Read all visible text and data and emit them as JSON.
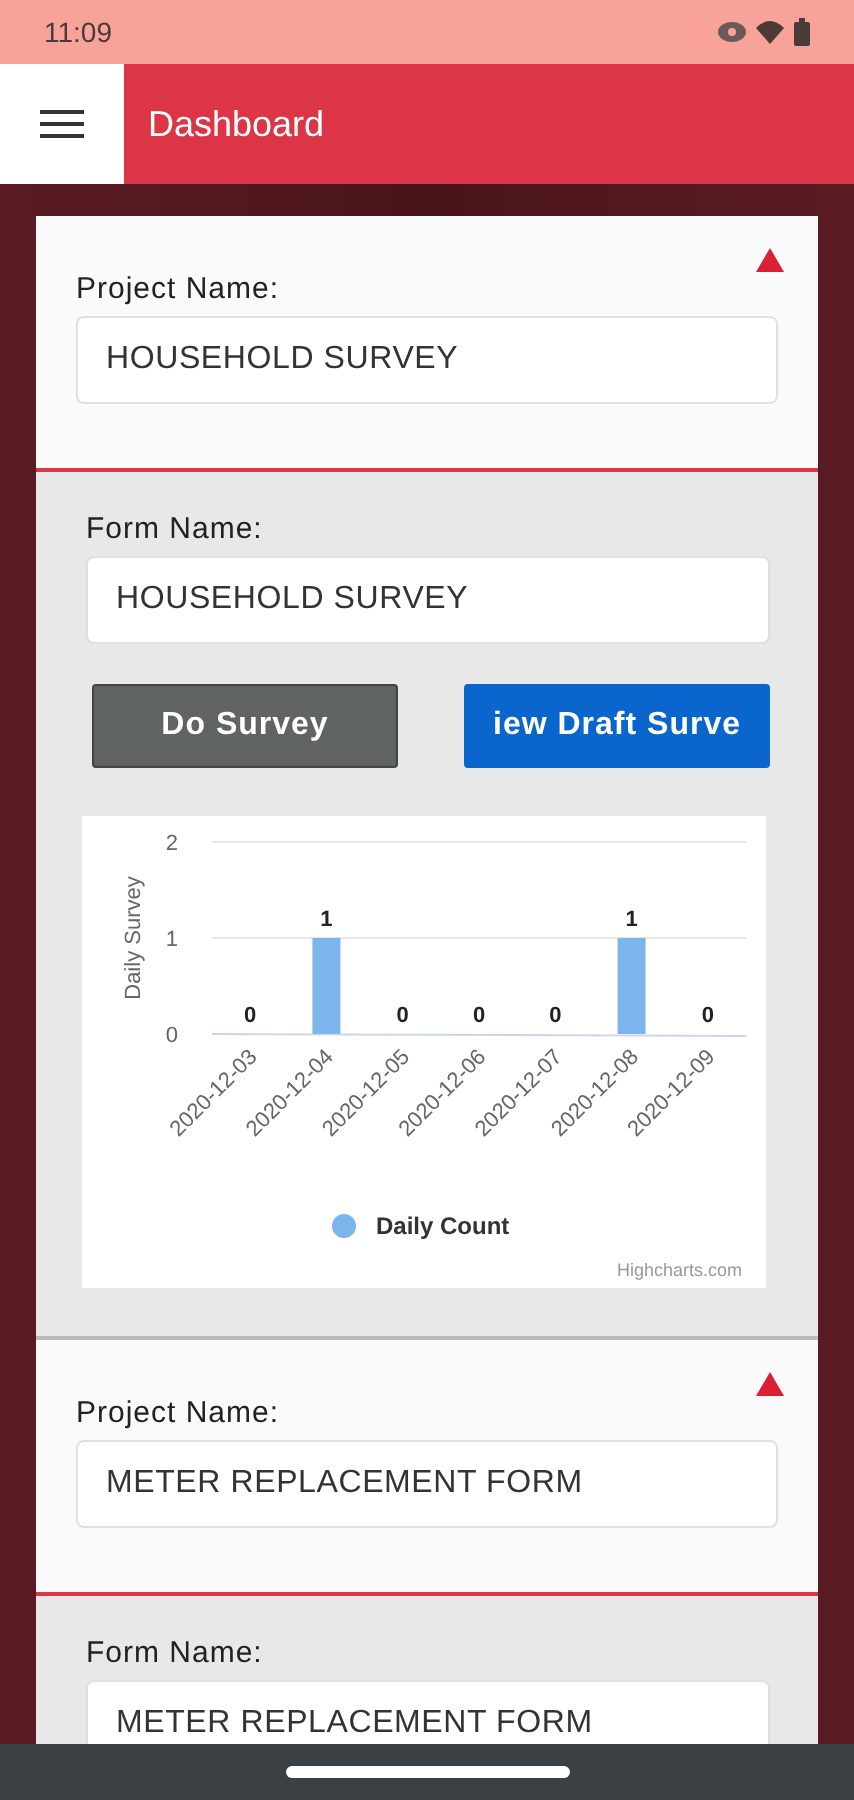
{
  "status_bar": {
    "time": "11:09"
  },
  "app_bar": {
    "title": "Dashboard"
  },
  "projects": [
    {
      "project_label": "Project Name:",
      "project_value": "HOUSEHOLD SURVEY",
      "warning": true,
      "form": {
        "form_label": "Form Name:",
        "form_value": "HOUSEHOLD SURVEY",
        "buttons": [
          {
            "label": "Do Survey",
            "kind": "primary"
          },
          {
            "label": "iew Draft Surve",
            "kind": "draft"
          }
        ],
        "chart_data": {
          "type": "bar",
          "ylabel": "Daily Survey",
          "categories": [
            "2020-12-03",
            "2020-12-04",
            "2020-12-05",
            "2020-12-06",
            "2020-12-07",
            "2020-12-08",
            "2020-12-09"
          ],
          "series": [
            {
              "name": "Daily Count",
              "color": "#7cb5ec",
              "values": [
                0,
                1,
                0,
                0,
                0,
                1,
                0
              ]
            }
          ],
          "ylim": [
            0,
            2
          ],
          "yticks": [
            0,
            1,
            2
          ],
          "data_labels": true
        },
        "credit": "Highcharts.com"
      }
    },
    {
      "project_label": "Project Name:",
      "project_value": "METER REPLACEMENT FORM",
      "warning": true,
      "form": {
        "form_label": "Form Name:",
        "form_value": "METER REPLACEMENT FORM"
      }
    }
  ]
}
